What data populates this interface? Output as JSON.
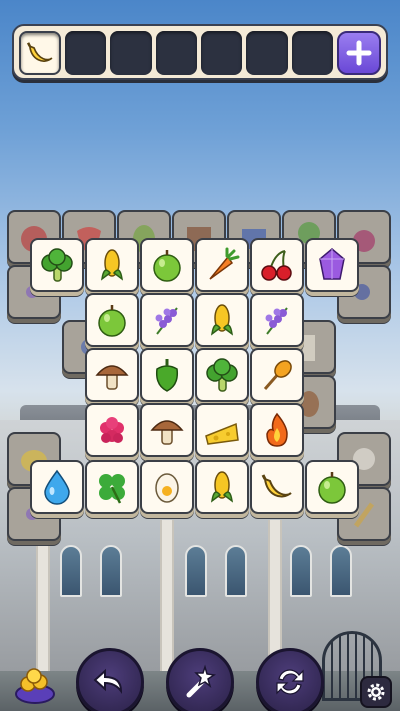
{
  "colors": {
    "tray_bg": "#f4ead7",
    "slot_empty": "#2c3140",
    "add_button": "#7a5be0",
    "tile_face": "#fffaf0",
    "tile_dim": "#a8a39a",
    "control_bg": "#2a2147"
  },
  "tray": {
    "slot_count": 7,
    "slots": [
      "banana",
      "",
      "",
      "",
      "",
      "",
      ""
    ],
    "add_button_icon": "plus-icon"
  },
  "board": {
    "top_layer": [
      [
        "broccoli",
        "corn",
        "green-apple",
        "carrot",
        "cherries",
        "amethyst"
      ],
      [
        "green-apple",
        "lavender",
        "corn",
        "lavender"
      ],
      [
        "mushroom",
        "green-pepper",
        "broccoli",
        "honey-dipper"
      ],
      [
        "raspberry",
        "mushroom",
        "cheese",
        "fire"
      ],
      [
        "water-drop",
        "clover",
        "egg",
        "corn",
        "banana",
        "green-apple"
      ]
    ],
    "lower_layer_visible": [
      "pomegranate",
      "strawberry",
      "avocado",
      "chocolate",
      "blueberry-carton",
      "broccoli",
      "beet",
      "lavender",
      "blueberries",
      "milk",
      "pinecone",
      "lemon",
      "cotton",
      "lavender",
      "strawberry",
      "blueberry",
      "wheat"
    ]
  },
  "controls": {
    "undo_icon": "undo-icon",
    "magic_wand_icon": "magic-wand-icon",
    "shuffle_icon": "shuffle-icon",
    "coins_icon": "coin-pot-icon",
    "settings_icon": "gear-icon"
  }
}
